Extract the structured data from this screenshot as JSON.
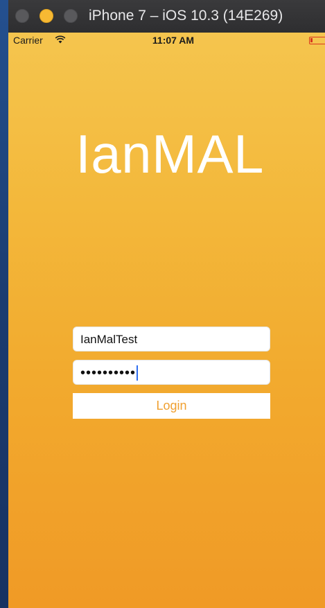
{
  "window": {
    "title": "iPhone 7 – iOS 10.3 (14E269)"
  },
  "status_bar": {
    "carrier": "Carrier",
    "time": "11:07 AM",
    "battery_color": "#d9361e"
  },
  "app": {
    "title": "IanMAL"
  },
  "login_form": {
    "username_value": "IanMalTest",
    "password_masked": "••••••••••",
    "login_label": "Login"
  },
  "colors": {
    "accent": "#f0a030",
    "background_top": "#f5c54e",
    "background_bottom": "#f09a26"
  }
}
